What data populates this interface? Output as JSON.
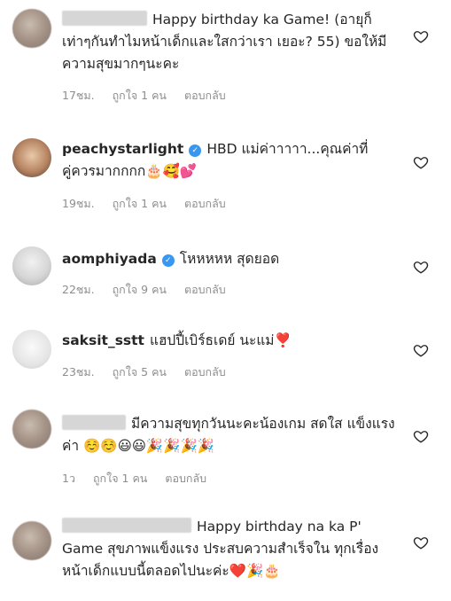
{
  "comments": [
    {
      "text": "Happy birthday ka Game! (อายุก็เท่าๆกันทำไมหน้าเด็กและใสกว่าเรา เยอะ? 55) ขอให้มีความสุขมากๆนะคะ",
      "time": "17ชม.",
      "likes": "ถูกใจ 1 คน",
      "reply": "ตอบกลับ",
      "avatar_icon": "blurred-avatar",
      "heart_icon": "heart-outline-icon"
    },
    {
      "username": "peachystarlight",
      "text": "HBD แม่ค่าาาาา...คุณค่าที่คู่ควรมากกกก🎂🥰💕",
      "time": "19ชม.",
      "likes": "ถูกใจ 1 คน",
      "reply": "ตอบกลับ",
      "avatar_icon": "user-avatar"
    },
    {
      "username": "aomphiyada",
      "text": "โหหหหห สุดยอด",
      "time": "22ชม.",
      "likes": "ถูกใจ 9 คน",
      "reply": "ตอบกลับ",
      "avatar_icon": "user-avatar"
    },
    {
      "username": "saksit_sstt",
      "text": "แฮปปี้เบิร์ธเดย์ นะแม่❣️",
      "time": "23ชม.",
      "likes": "ถูกใจ 5 คน",
      "reply": "ตอบกลับ",
      "avatar_icon": "user-avatar"
    },
    {
      "text": "มีความสุขทุกวันนะคะน้องเกม สดใส แข็งแรงค่า ☺️☺️😃😃🎉🎉🎉🎉",
      "time": "1ว",
      "likes": "ถูกใจ 1 คน",
      "reply": "ตอบกลับ",
      "avatar_icon": "blurred-avatar"
    },
    {
      "text": "Happy birthday na ka P' Game สุขภาพแข็งแรง ประสบความสำเร็จใน ทุกเรื่อง หน้าเด็กแบบนี้ตลอดไปนะค่ะ❤️🎉🎂",
      "avatar_icon": "blurred-avatar"
    }
  ],
  "colors": {
    "text": "#262626",
    "meta": "#8e8e8e",
    "verified": "#3897f0"
  }
}
